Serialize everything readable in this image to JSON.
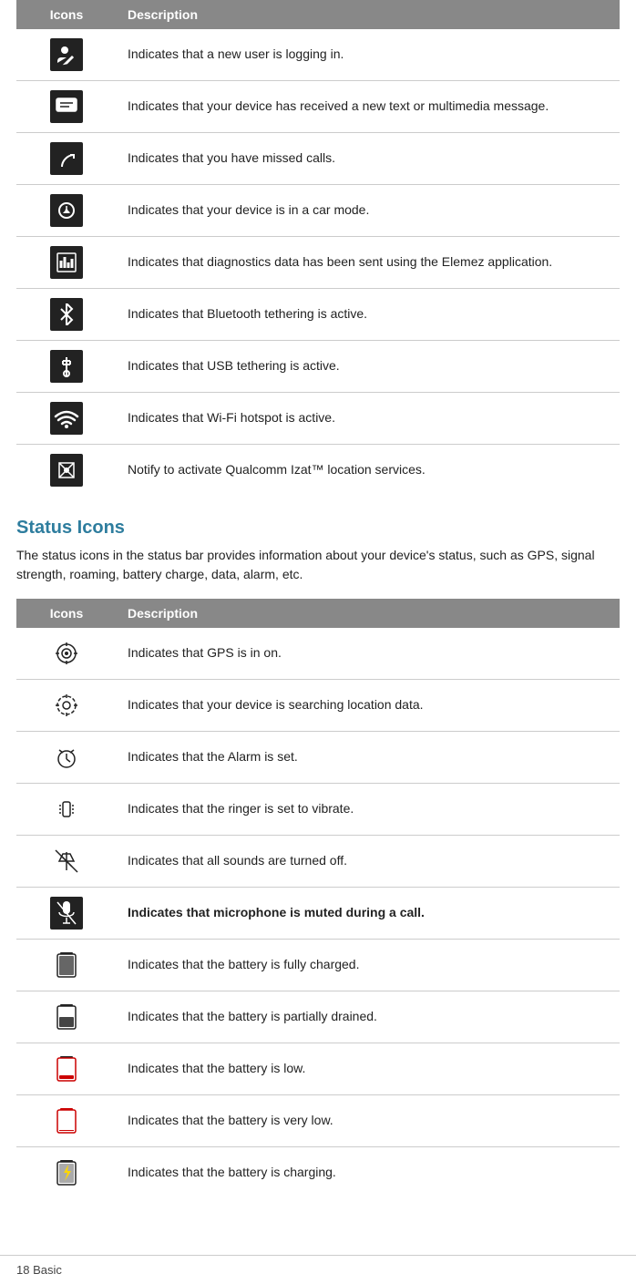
{
  "notification_table": {
    "headers": [
      "Icons",
      "Description"
    ],
    "rows": [
      {
        "icon": "👤✏",
        "icon_unicode": "🧑",
        "description": "Indicates that a new user is logging  in.",
        "icon_symbol": "person-edit"
      },
      {
        "icon": "💬",
        "description": "Indicates that your device has received a new text or multimedia  message.",
        "icon_symbol": "message"
      },
      {
        "icon": "📵",
        "description": "Indicates that you have missed  calls.",
        "icon_symbol": "missed-call"
      },
      {
        "icon": "🚗",
        "description": "Indicates that your device is in a car  mode.",
        "icon_symbol": "car-mode"
      },
      {
        "icon": "📊",
        "description": "Indicates that diagnostics data has been sent using the Elemez  application.",
        "icon_symbol": "diagnostics"
      },
      {
        "icon": "🔵",
        "description": "Indicates that Bluetooth tethering is  active.",
        "icon_symbol": "bluetooth-tethering"
      },
      {
        "icon": "🔌",
        "description": "Indicates that USB tethering is  active.",
        "icon_symbol": "usb-tethering"
      },
      {
        "icon": "📶",
        "description": "Indicates that Wi-Fi hotspot is  active.",
        "icon_symbol": "wifi-hotspot"
      },
      {
        "icon": "📍",
        "description": "Notify to activate Qualcomm Izat™ location  services.",
        "icon_symbol": "location-services"
      }
    ]
  },
  "status_section": {
    "title": "Status Icons",
    "description": "The status icons in the status bar provides information about your device's status, such as GPS, signal strength, roaming, battery charge, data, alarm,  etc."
  },
  "status_table": {
    "headers": [
      "Icons",
      "Description"
    ],
    "rows": [
      {
        "icon": "🎯",
        "description": "Indicates that GPS is in on.",
        "icon_symbol": "gps-on",
        "highlight": false
      },
      {
        "icon": "◎",
        "description": "Indicates that your device is searching location  data.",
        "icon_symbol": "gps-searching",
        "highlight": false
      },
      {
        "icon": "⏰",
        "description": "Indicates that the Alarm is  set.",
        "icon_symbol": "alarm",
        "highlight": false
      },
      {
        "icon": "📳",
        "description": "Indicates that the ringer is set to  vibrate.",
        "icon_symbol": "vibrate",
        "highlight": false
      },
      {
        "icon": "🔇",
        "description": "Indicates that all sounds are turned  off.",
        "icon_symbol": "silent",
        "highlight": false
      },
      {
        "icon": "🎤",
        "description": "Indicates that microphone is muted during a call.",
        "icon_symbol": "mic-muted",
        "highlight": true
      },
      {
        "icon": "🔋",
        "description": "Indicates that the battery is fully  charged.",
        "icon_symbol": "battery-full",
        "highlight": false
      },
      {
        "icon": "🔋",
        "description": "Indicates that the battery is partially  drained.",
        "icon_symbol": "battery-partial",
        "highlight": false
      },
      {
        "icon": "🔋",
        "description": "Indicates that the battery is  low.",
        "icon_symbol": "battery-low",
        "highlight": false
      },
      {
        "icon": "🔋",
        "description": "Indicates that the battery is very  low.",
        "icon_symbol": "battery-very-low",
        "highlight": false
      },
      {
        "icon": "🔋",
        "description": "Indicates that the battery is  charging.",
        "icon_symbol": "battery-charging",
        "highlight": false
      }
    ]
  },
  "footer": {
    "text": "18  Basic"
  }
}
